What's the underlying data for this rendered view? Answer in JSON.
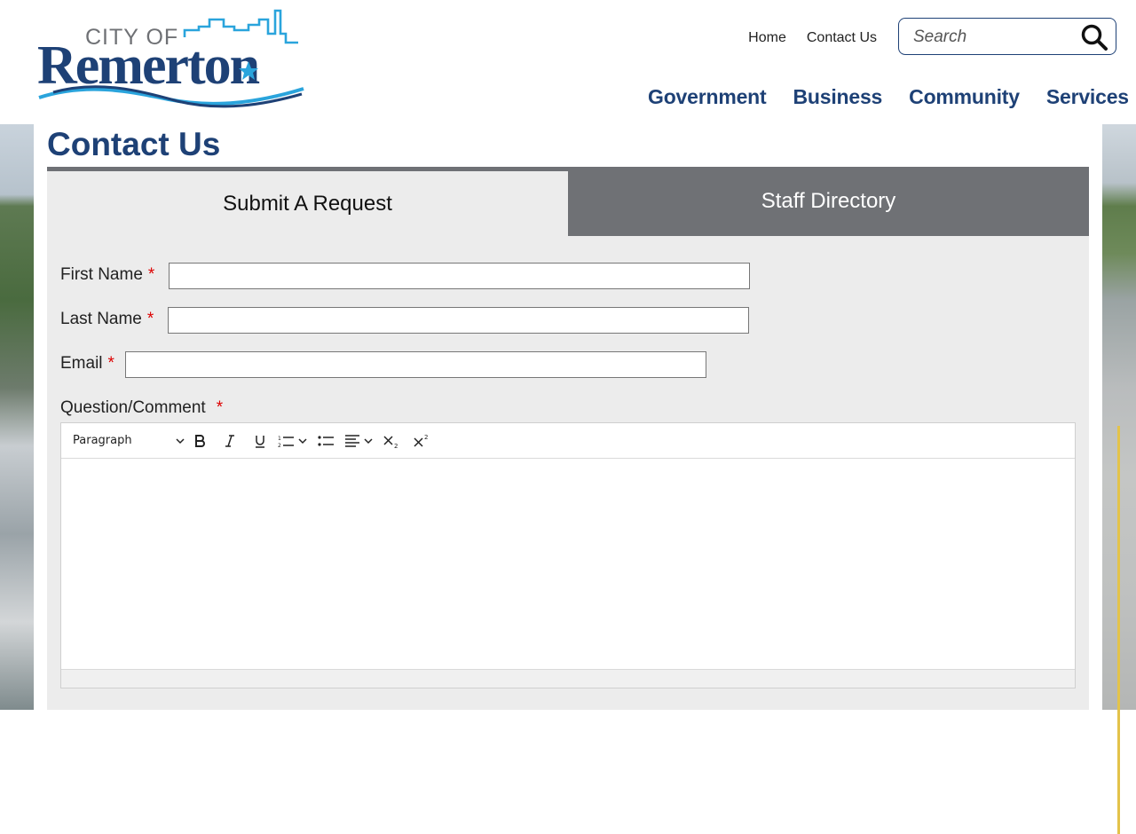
{
  "logo": {
    "line1": "CITY OF",
    "line2": "Remerton"
  },
  "header": {
    "links": [
      "Home",
      "Contact Us"
    ],
    "search_placeholder": "Search",
    "nav": [
      "Government",
      "Business",
      "Community",
      "Services"
    ]
  },
  "page": {
    "title": "Contact Us"
  },
  "tabs": [
    {
      "label": "Submit A Request",
      "active": true
    },
    {
      "label": "Staff Directory",
      "active": false
    }
  ],
  "form": {
    "fields": [
      {
        "label": "First Name",
        "required_mark": "*",
        "value": ""
      },
      {
        "label": "Last Name",
        "required_mark": "*",
        "value": ""
      },
      {
        "label": "Email",
        "required_mark": "*",
        "value": ""
      }
    ],
    "comment_label": "Question/Comment",
    "comment_required_mark": "*",
    "editor": {
      "block_format": "Paragraph",
      "buttons": [
        "bold-icon",
        "italic-icon",
        "underline-icon",
        "numbered-list-icon",
        "bullet-list-icon",
        "align-icon",
        "subscript-icon",
        "superscript-icon"
      ],
      "content": ""
    }
  },
  "colors": {
    "brand": "#1e4176",
    "accent": "#2aa4dc",
    "tab_inactive": "#6f7175",
    "required": "#dd0000"
  }
}
